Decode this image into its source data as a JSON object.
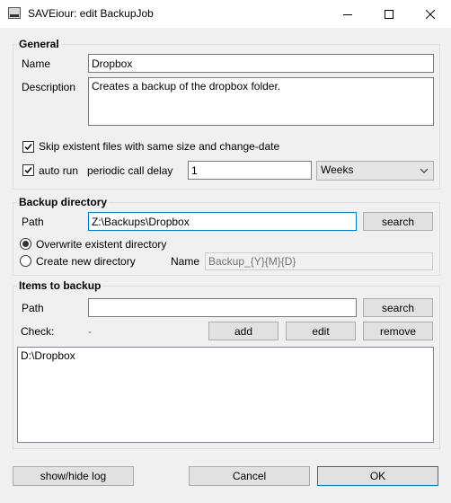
{
  "window": {
    "title": "SAVEiour: edit BackupJob"
  },
  "general": {
    "title": "General",
    "name_label": "Name",
    "name_value": "Dropbox",
    "description_label": "Description",
    "description_value": "Creates a backup of the dropbox folder.",
    "skip_label": "Skip existent files with same size and change-date",
    "skip_checked": true,
    "autorun_label": "auto run",
    "autorun_checked": true,
    "delay_label": "periodic call delay",
    "delay_value": "1",
    "unit_value": "Weeks"
  },
  "backup_directory": {
    "title": "Backup directory",
    "path_label": "Path",
    "path_value": "Z:\\Backups\\Dropbox",
    "search_label": "search",
    "overwrite_label": "Overwrite existent directory",
    "create_label": "Create new directory",
    "selected_option": "overwrite",
    "name_label": "Name",
    "name_placeholder": "Backup_{Y}{M}{D}"
  },
  "items": {
    "title": "Items to backup",
    "path_label": "Path",
    "path_value": "",
    "search_label": "search",
    "check_label": "Check:",
    "check_value": "-",
    "add_label": "add",
    "edit_label": "edit",
    "remove_label": "remove",
    "list": [
      "D:\\Dropbox"
    ]
  },
  "footer": {
    "log_label": "show/hide log",
    "cancel_label": "Cancel",
    "ok_label": "OK"
  }
}
